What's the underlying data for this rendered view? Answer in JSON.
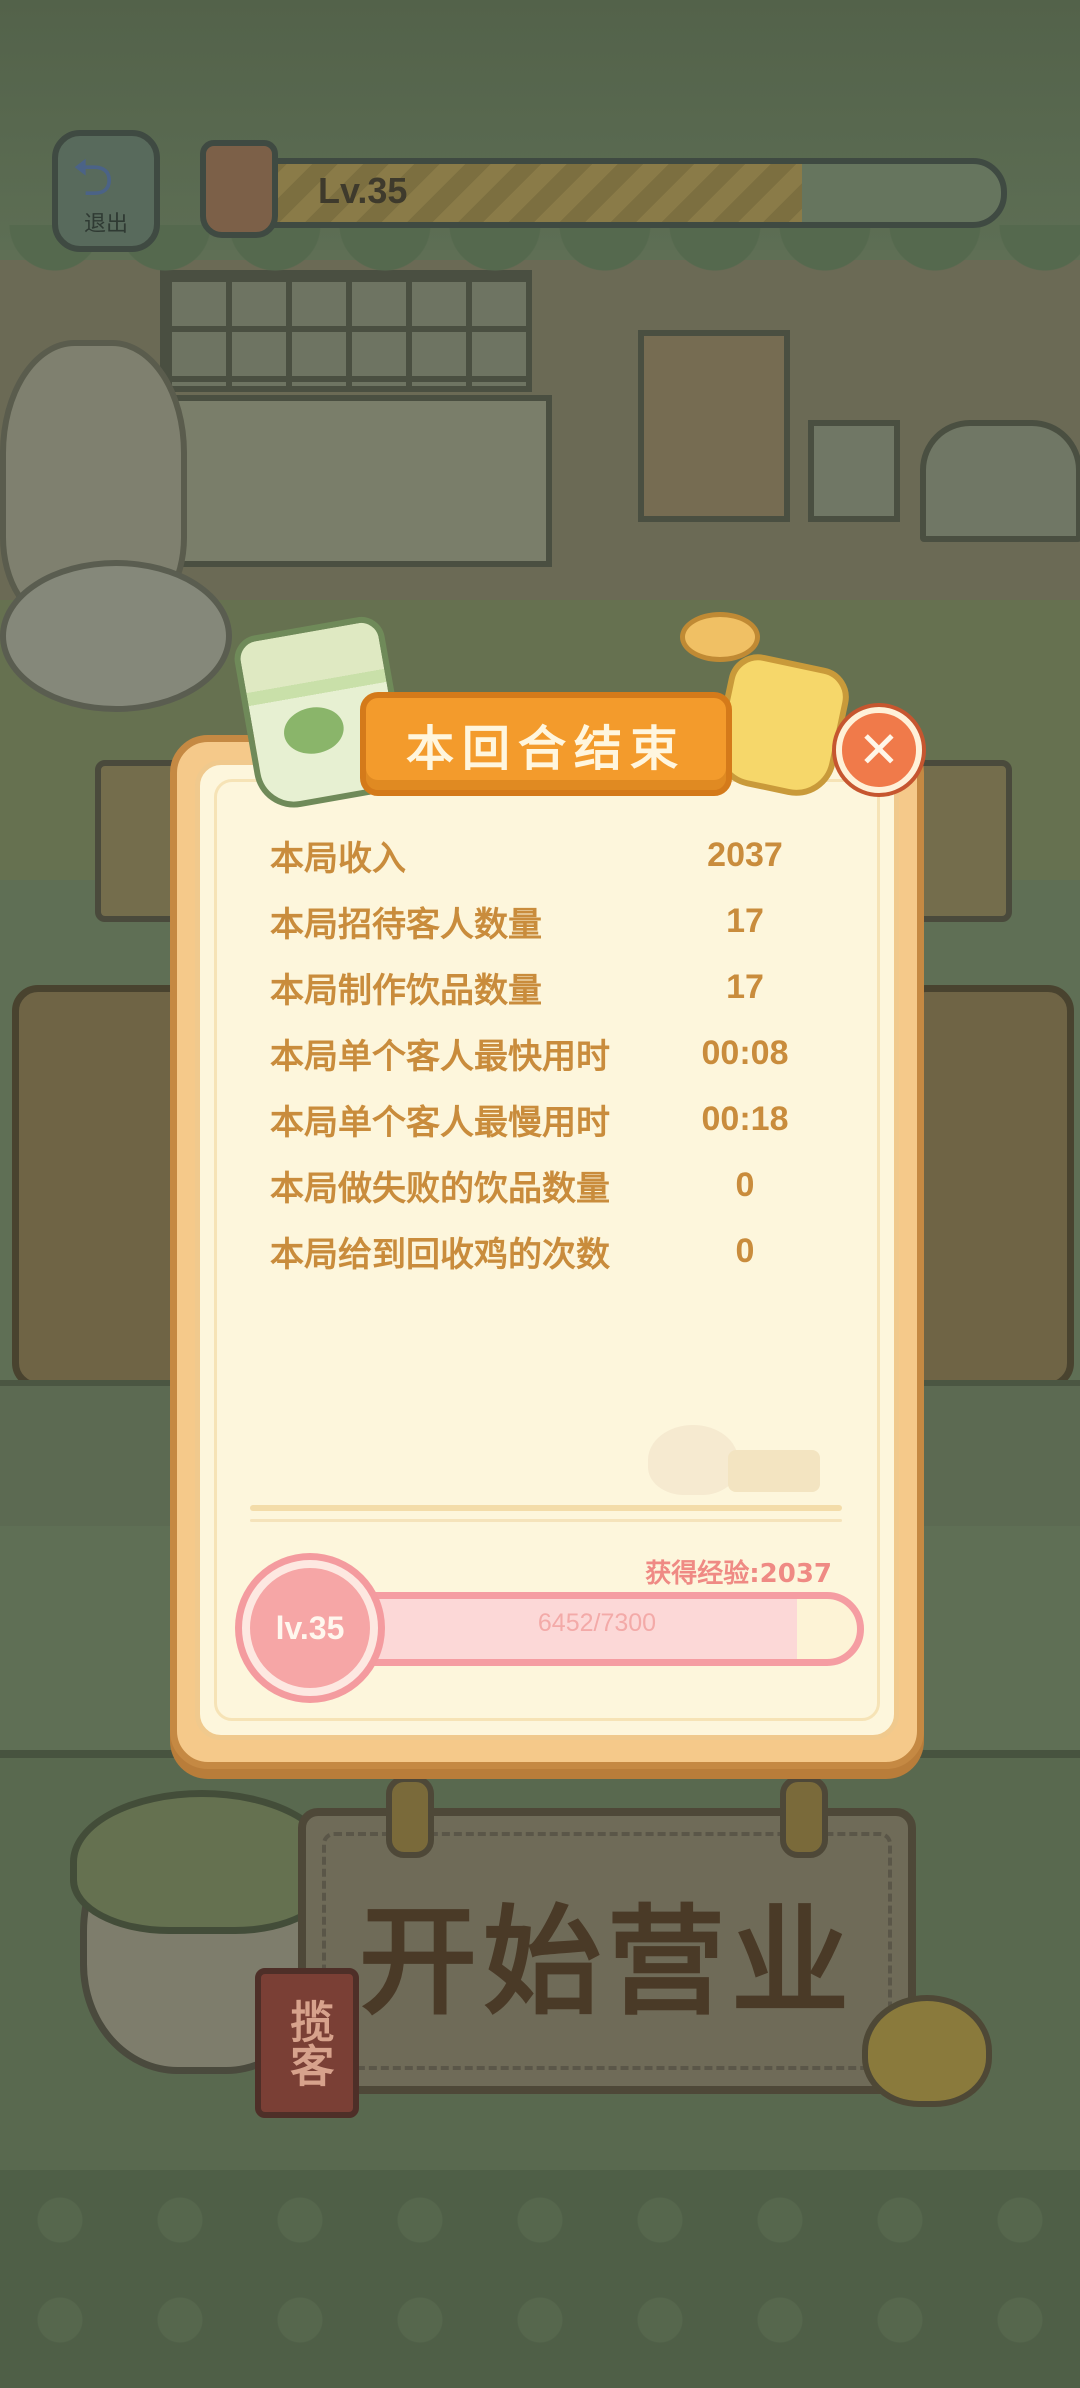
{
  "hud": {
    "exit_label": "退出",
    "level_label": "Lv.35",
    "level_progress": 0.74
  },
  "dialog": {
    "title": "本回合结束",
    "stats": [
      {
        "label": "本局收入",
        "value": "2037"
      },
      {
        "label": "本局招待客人数量",
        "value": "17"
      },
      {
        "label": "本局制作饮品数量",
        "value": "17"
      },
      {
        "label": "本局单个客人最快用时",
        "value": "00:08"
      },
      {
        "label": "本局单个客人最慢用时",
        "value": "00:18"
      },
      {
        "label": "本局做失败的饮品数量",
        "value": "0"
      },
      {
        "label": "本局给到回收鸡的次数",
        "value": "0"
      }
    ],
    "exp_gained": "获得经验:2037",
    "level_badge": "lv.35",
    "exp_progress_text": "6452/7300",
    "exp_current": 6452,
    "exp_max": 7300
  },
  "background": {
    "start_sign": "开始营业",
    "solicit_label": "揽客"
  },
  "colors": {
    "panel": "#fdf6dc",
    "title_ribbon": "#f39b2c",
    "stat_text": "#c98c3c",
    "exp_accent": "#f59da2",
    "close_button": "#f07a4a"
  }
}
